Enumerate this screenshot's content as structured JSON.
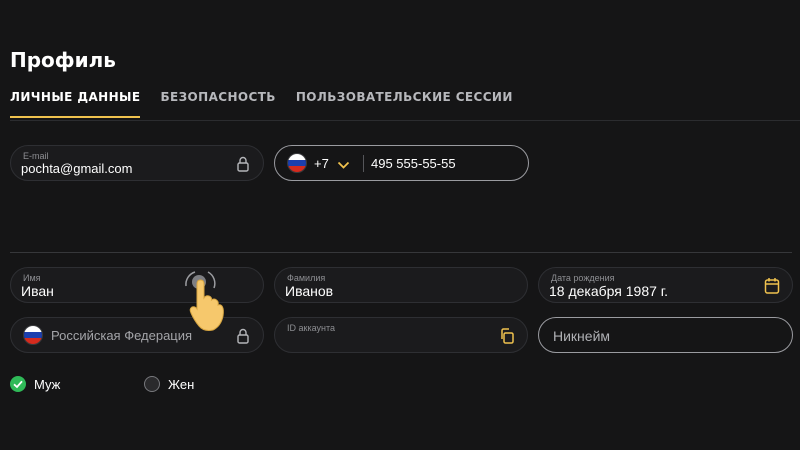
{
  "page": {
    "title": "Профиль"
  },
  "tabs": [
    {
      "label": "ЛИЧНЫЕ ДАННЫЕ",
      "active": true
    },
    {
      "label": "БЕЗОПАСНОСТЬ",
      "active": false
    },
    {
      "label": "ПОЛЬЗОВАТЕЛЬСКИЕ СЕССИИ",
      "active": false
    }
  ],
  "contact": {
    "email": {
      "label": "E-mail",
      "value": "pochta@gmail.com",
      "locked": true
    },
    "phone": {
      "country_code": "+7",
      "number": "495 555-55-55"
    }
  },
  "personal": {
    "first_name": {
      "label": "Имя",
      "value": "Иван"
    },
    "last_name": {
      "label": "Фамилия",
      "value": "Иванов"
    },
    "birth_date": {
      "label": "Дата рождения",
      "value": "18 декабря 1987 г."
    },
    "country": {
      "value": "Российская Федерация",
      "locked": true
    },
    "account_id": {
      "label": "ID аккаунта",
      "value": ""
    },
    "nickname": {
      "placeholder": "Никнейм",
      "value": ""
    }
  },
  "gender": {
    "options": [
      {
        "label": "Муж",
        "selected": true
      },
      {
        "label": "Жен",
        "selected": false
      }
    ]
  },
  "colors": {
    "accent": "#f0c24e",
    "background": "#151516",
    "selected": "#2fba58"
  },
  "icons": {
    "email_lock": "lock-icon",
    "country_lock": "lock-icon",
    "calendar": "calendar-icon",
    "copy": "copy-icon",
    "dropdown": "chevron-down-icon",
    "pointer": "tap-hand-icon"
  }
}
